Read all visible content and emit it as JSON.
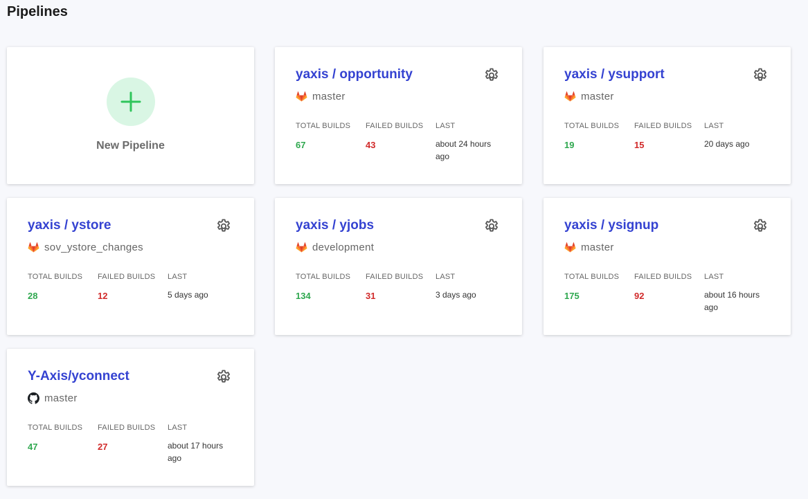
{
  "page": {
    "title": "Pipelines"
  },
  "new_pipeline": {
    "label": "New Pipeline"
  },
  "labels": {
    "total_builds": "TOTAL BUILDS",
    "failed_builds": "FAILED BUILDS",
    "last": "LAST"
  },
  "colors": {
    "title_blue": "#3442d1",
    "total_green": "#2fa84f",
    "failed_red": "#d12b2b",
    "plus_green": "#2fc55b"
  },
  "pipelines": [
    {
      "title": "yaxis / opportunity",
      "branch": "master",
      "provider": "gitlab",
      "total": "67",
      "failed": "43",
      "last": "about 24 hours ago"
    },
    {
      "title": "yaxis / ysupport",
      "branch": "master",
      "provider": "gitlab",
      "total": "19",
      "failed": "15",
      "last": "20 days ago"
    },
    {
      "title": "yaxis / ystore",
      "branch": "sov_ystore_changes",
      "provider": "gitlab",
      "total": "28",
      "failed": "12",
      "last": "5 days ago"
    },
    {
      "title": "yaxis / yjobs",
      "branch": "development",
      "provider": "gitlab",
      "total": "134",
      "failed": "31",
      "last": "3 days ago"
    },
    {
      "title": "yaxis / ysignup",
      "branch": "master",
      "provider": "gitlab",
      "total": "175",
      "failed": "92",
      "last": "about 16 hours ago"
    },
    {
      "title": "Y-Axis/yconnect",
      "branch": "master",
      "provider": "github",
      "total": "47",
      "failed": "27",
      "last": "about 17 hours ago"
    }
  ]
}
